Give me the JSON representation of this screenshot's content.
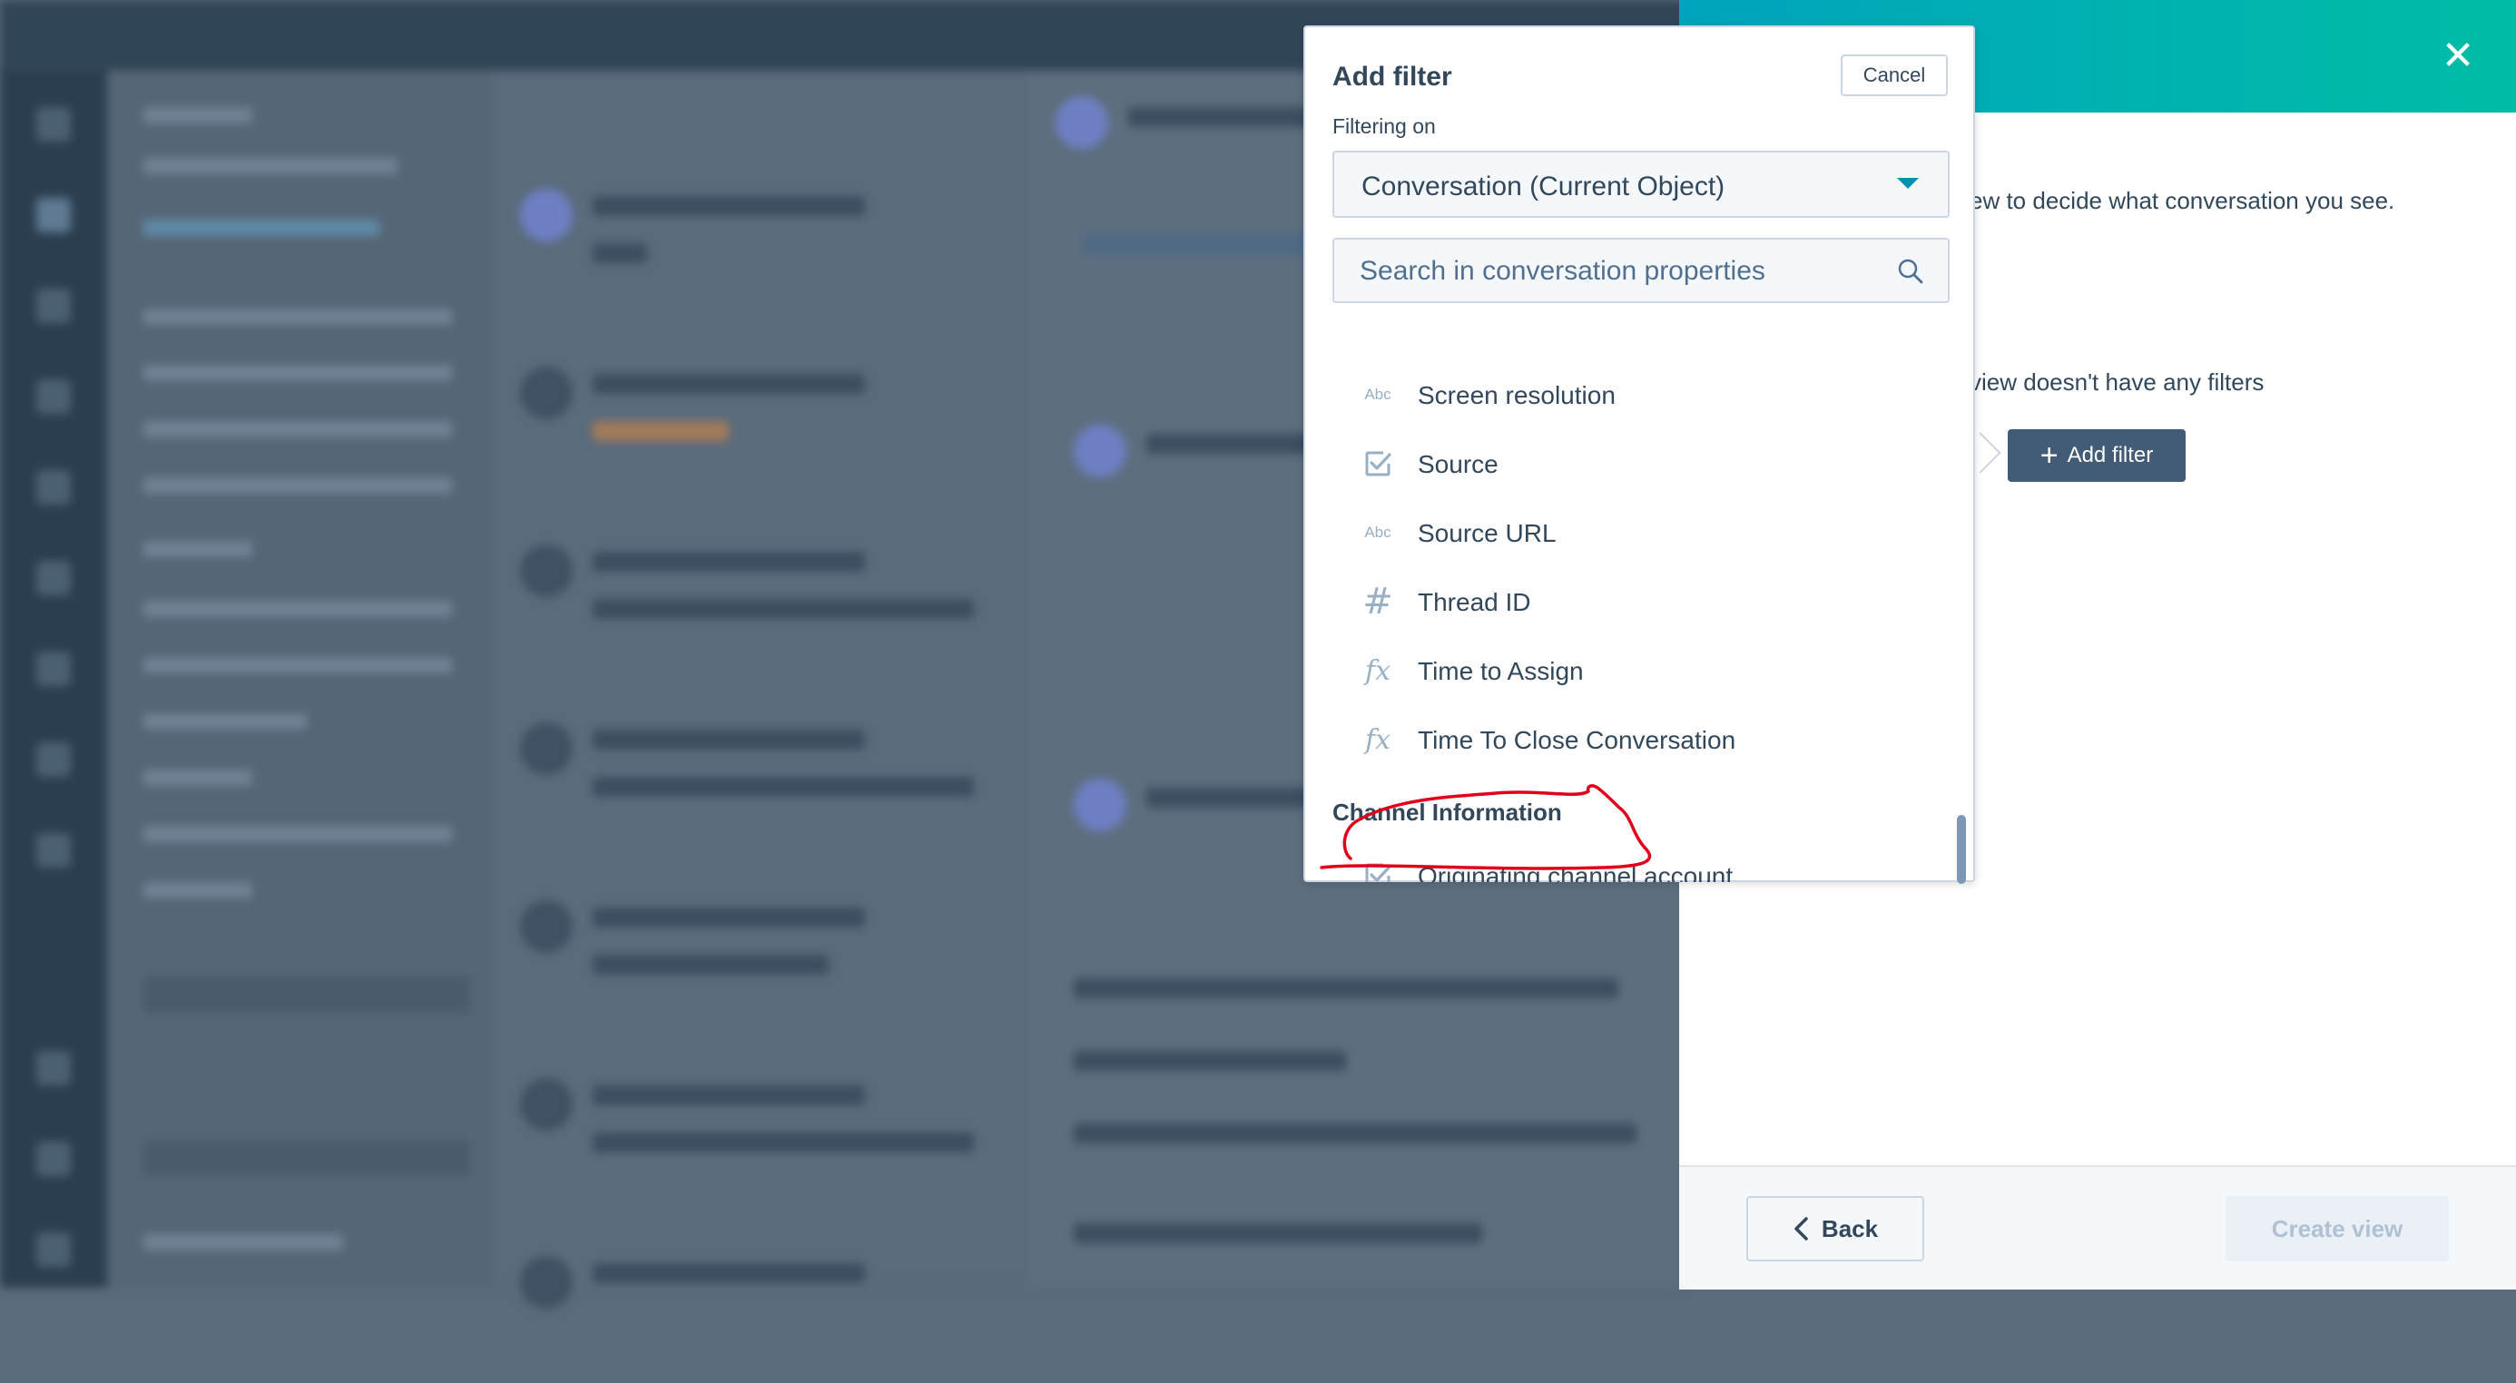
{
  "popover": {
    "title": "Add filter",
    "cancel_label": "Cancel",
    "filtering_label": "Filtering on",
    "object_select_value": "Conversation (Current Object)",
    "search_placeholder": "Search in conversation properties",
    "properties": [
      {
        "label": "Screen resolution",
        "icon": "abc-icon",
        "icon_text": "Abc"
      },
      {
        "label": "Source",
        "icon": "checkbox-icon"
      },
      {
        "label": "Source URL",
        "icon": "abc-icon",
        "icon_text": "Abc"
      },
      {
        "label": "Thread ID",
        "icon": "hash-icon",
        "icon_text": "#"
      },
      {
        "label": "Time to Assign",
        "icon": "function-icon",
        "icon_text": "fx"
      },
      {
        "label": "Time To Close Conversation",
        "icon": "function-icon",
        "icon_text": "fx"
      }
    ],
    "section_heading": "Channel Information",
    "section_properties": [
      {
        "label": "Originating channel account",
        "icon": "checkbox-icon"
      }
    ]
  },
  "panel": {
    "description": "ew to decide what conversation you see.",
    "no_filters_text": "view doesn't have any filters",
    "add_filter_label": "Add filter",
    "back_label": "Back",
    "create_view_label": "Create view"
  },
  "colors": {
    "header_gradient_start": "#00a4bd",
    "header_gradient_end": "#00bda5",
    "primary_button": "#425b76",
    "annotation": "#e0001b",
    "text": "#33475b"
  }
}
